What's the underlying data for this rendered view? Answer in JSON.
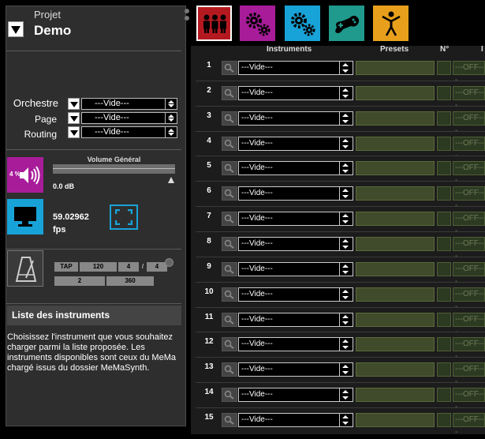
{
  "project": {
    "label": "Projet",
    "name": "Demo"
  },
  "routing_panel": {
    "orchestre": {
      "label": "Orchestre",
      "value": "---Vide---"
    },
    "page": {
      "label": "Page",
      "value": "---Vide---"
    },
    "routing": {
      "label": "Routing",
      "value": "---Vide---"
    }
  },
  "volume": {
    "badge": "4 %",
    "title": "Volume Général",
    "db": "0.0 dB",
    "level": 0.97
  },
  "display": {
    "fps_value": "59.02962",
    "fps_unit": "fps"
  },
  "metronome": {
    "tap": "TAP",
    "bpm": "120",
    "beats": "4",
    "slash": "/",
    "unit": "4",
    "bars": "2",
    "ticks": "360"
  },
  "instrument_list": {
    "title": "Liste des instruments",
    "help": "Choisissez l'instrument que vous souhaitez charger parmi la liste proposée. Les instruments disponibles sont ceux du MeMa chargé issus du dossier MeMaSynth."
  },
  "tabs": [
    {
      "icon": "orchestra-icon",
      "active": true,
      "color": "#b51920"
    },
    {
      "icon": "gears-icon",
      "active": false,
      "color": "#a81c9a"
    },
    {
      "icon": "gears-icon",
      "active": false,
      "color": "#18a3d8"
    },
    {
      "icon": "gamepad-icon",
      "active": false,
      "color": "#1f9a8c"
    },
    {
      "icon": "accessibility-icon",
      "active": false,
      "color": "#e8a01c"
    }
  ],
  "grid": {
    "columns": {
      "instruments": "Instruments",
      "presets": "Presets",
      "number": "N°",
      "extra": "I"
    },
    "rows": [
      {
        "n": "1",
        "instrument": "---Vide---",
        "state": "---OFF---"
      },
      {
        "n": "2",
        "instrument": "---Vide---",
        "state": "---OFF---"
      },
      {
        "n": "3",
        "instrument": "---Vide---",
        "state": "---OFF---"
      },
      {
        "n": "4",
        "instrument": "---Vide---",
        "state": "---OFF---"
      },
      {
        "n": "5",
        "instrument": "---Vide---",
        "state": "---OFF---"
      },
      {
        "n": "6",
        "instrument": "---Vide---",
        "state": "---OFF---"
      },
      {
        "n": "7",
        "instrument": "---Vide---",
        "state": "---OFF---"
      },
      {
        "n": "8",
        "instrument": "---Vide---",
        "state": "---OFF---"
      },
      {
        "n": "9",
        "instrument": "---Vide---",
        "state": "---OFF---"
      },
      {
        "n": "10",
        "instrument": "---Vide---",
        "state": "---OFF---"
      },
      {
        "n": "11",
        "instrument": "---Vide---",
        "state": "---OFF---"
      },
      {
        "n": "12",
        "instrument": "---Vide---",
        "state": "---OFF---"
      },
      {
        "n": "13",
        "instrument": "---Vide---",
        "state": "---OFF---"
      },
      {
        "n": "14",
        "instrument": "---Vide---",
        "state": "---OFF---"
      },
      {
        "n": "15",
        "instrument": "---Vide---",
        "state": "---OFF---"
      }
    ]
  }
}
